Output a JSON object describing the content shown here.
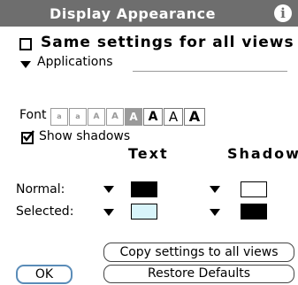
{
  "title": "Display Appearance",
  "info_icon": "i",
  "same_settings_label": "Same settings for all views",
  "category": "Applications",
  "font_label": "Font",
  "font_options": [
    "a",
    "a",
    "A",
    "A",
    "A",
    "A",
    "A",
    "A"
  ],
  "selected_font_index": 4,
  "show_shadows_label": "Show shadows",
  "show_shadows_checked": true,
  "columns": {
    "text": "Text",
    "shadow": "Shadow"
  },
  "rows": {
    "normal": {
      "label": "Normal:",
      "text_color": "#000000",
      "shadow_color": "#ffffff"
    },
    "selected": {
      "label": "Selected:",
      "text_color": "#d8f4fa",
      "shadow_color": "#000000"
    }
  },
  "buttons": {
    "copy": "Copy settings to all views",
    "ok": "OK",
    "restore": "Restore Defaults"
  }
}
